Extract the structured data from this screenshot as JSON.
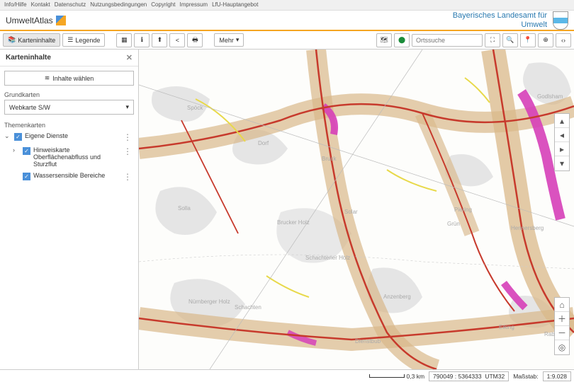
{
  "topnav": [
    "Info/Hilfe",
    "Kontakt",
    "Datenschutz",
    "Nutzungsbedingungen",
    "Copyright",
    "Impressum",
    "LfU-Hauptangebot"
  ],
  "brand": "UmweltAtlas",
  "org_line1": "Bayerisches Landesamt für",
  "org_line2": "Umwelt",
  "toolbar": {
    "karteninhalte": "Karteninhalte",
    "legende": "Legende",
    "mehr": "Mehr",
    "search_placeholder": "Ortssuche"
  },
  "panel": {
    "title": "Karteninhalte",
    "select_btn": "Inhalte wählen",
    "grundkarten": "Grundkarten",
    "basemap": "Webkarte S/W",
    "themenkarten": "Themenkarten",
    "layer_eigene": "Eigene Dienste",
    "layer_hinweis": "Hinweiskarte Oberflächenabfluss und Sturzflut",
    "layer_wasser": "Wassersensible Bereiche"
  },
  "places": {
    "spock": "Spöck",
    "dorf": "Dorf",
    "solla": "Solla",
    "bruck": "Bruck",
    "solar": "Solar",
    "brucker": "Brucker Holz",
    "schachtener": "Schachtener Holz",
    "nurnberger": "Nürnberger Holz",
    "schachten": "Schachten",
    "anzenberg": "Anzenberg",
    "dienstbub": "Dienstbub",
    "piering": "Piering",
    "grun": "Grün",
    "hennersberg": "Hennersberg",
    "eiking": "Eiking",
    "rabens": "Rabens",
    "godlsham": "Godlsham"
  },
  "footer": {
    "scale_dist": "0,3 km",
    "coords": "790049 : 5364333",
    "crs": "UTM32",
    "massstab_lbl": "Maßstab:",
    "massstab": "1:9.028"
  }
}
